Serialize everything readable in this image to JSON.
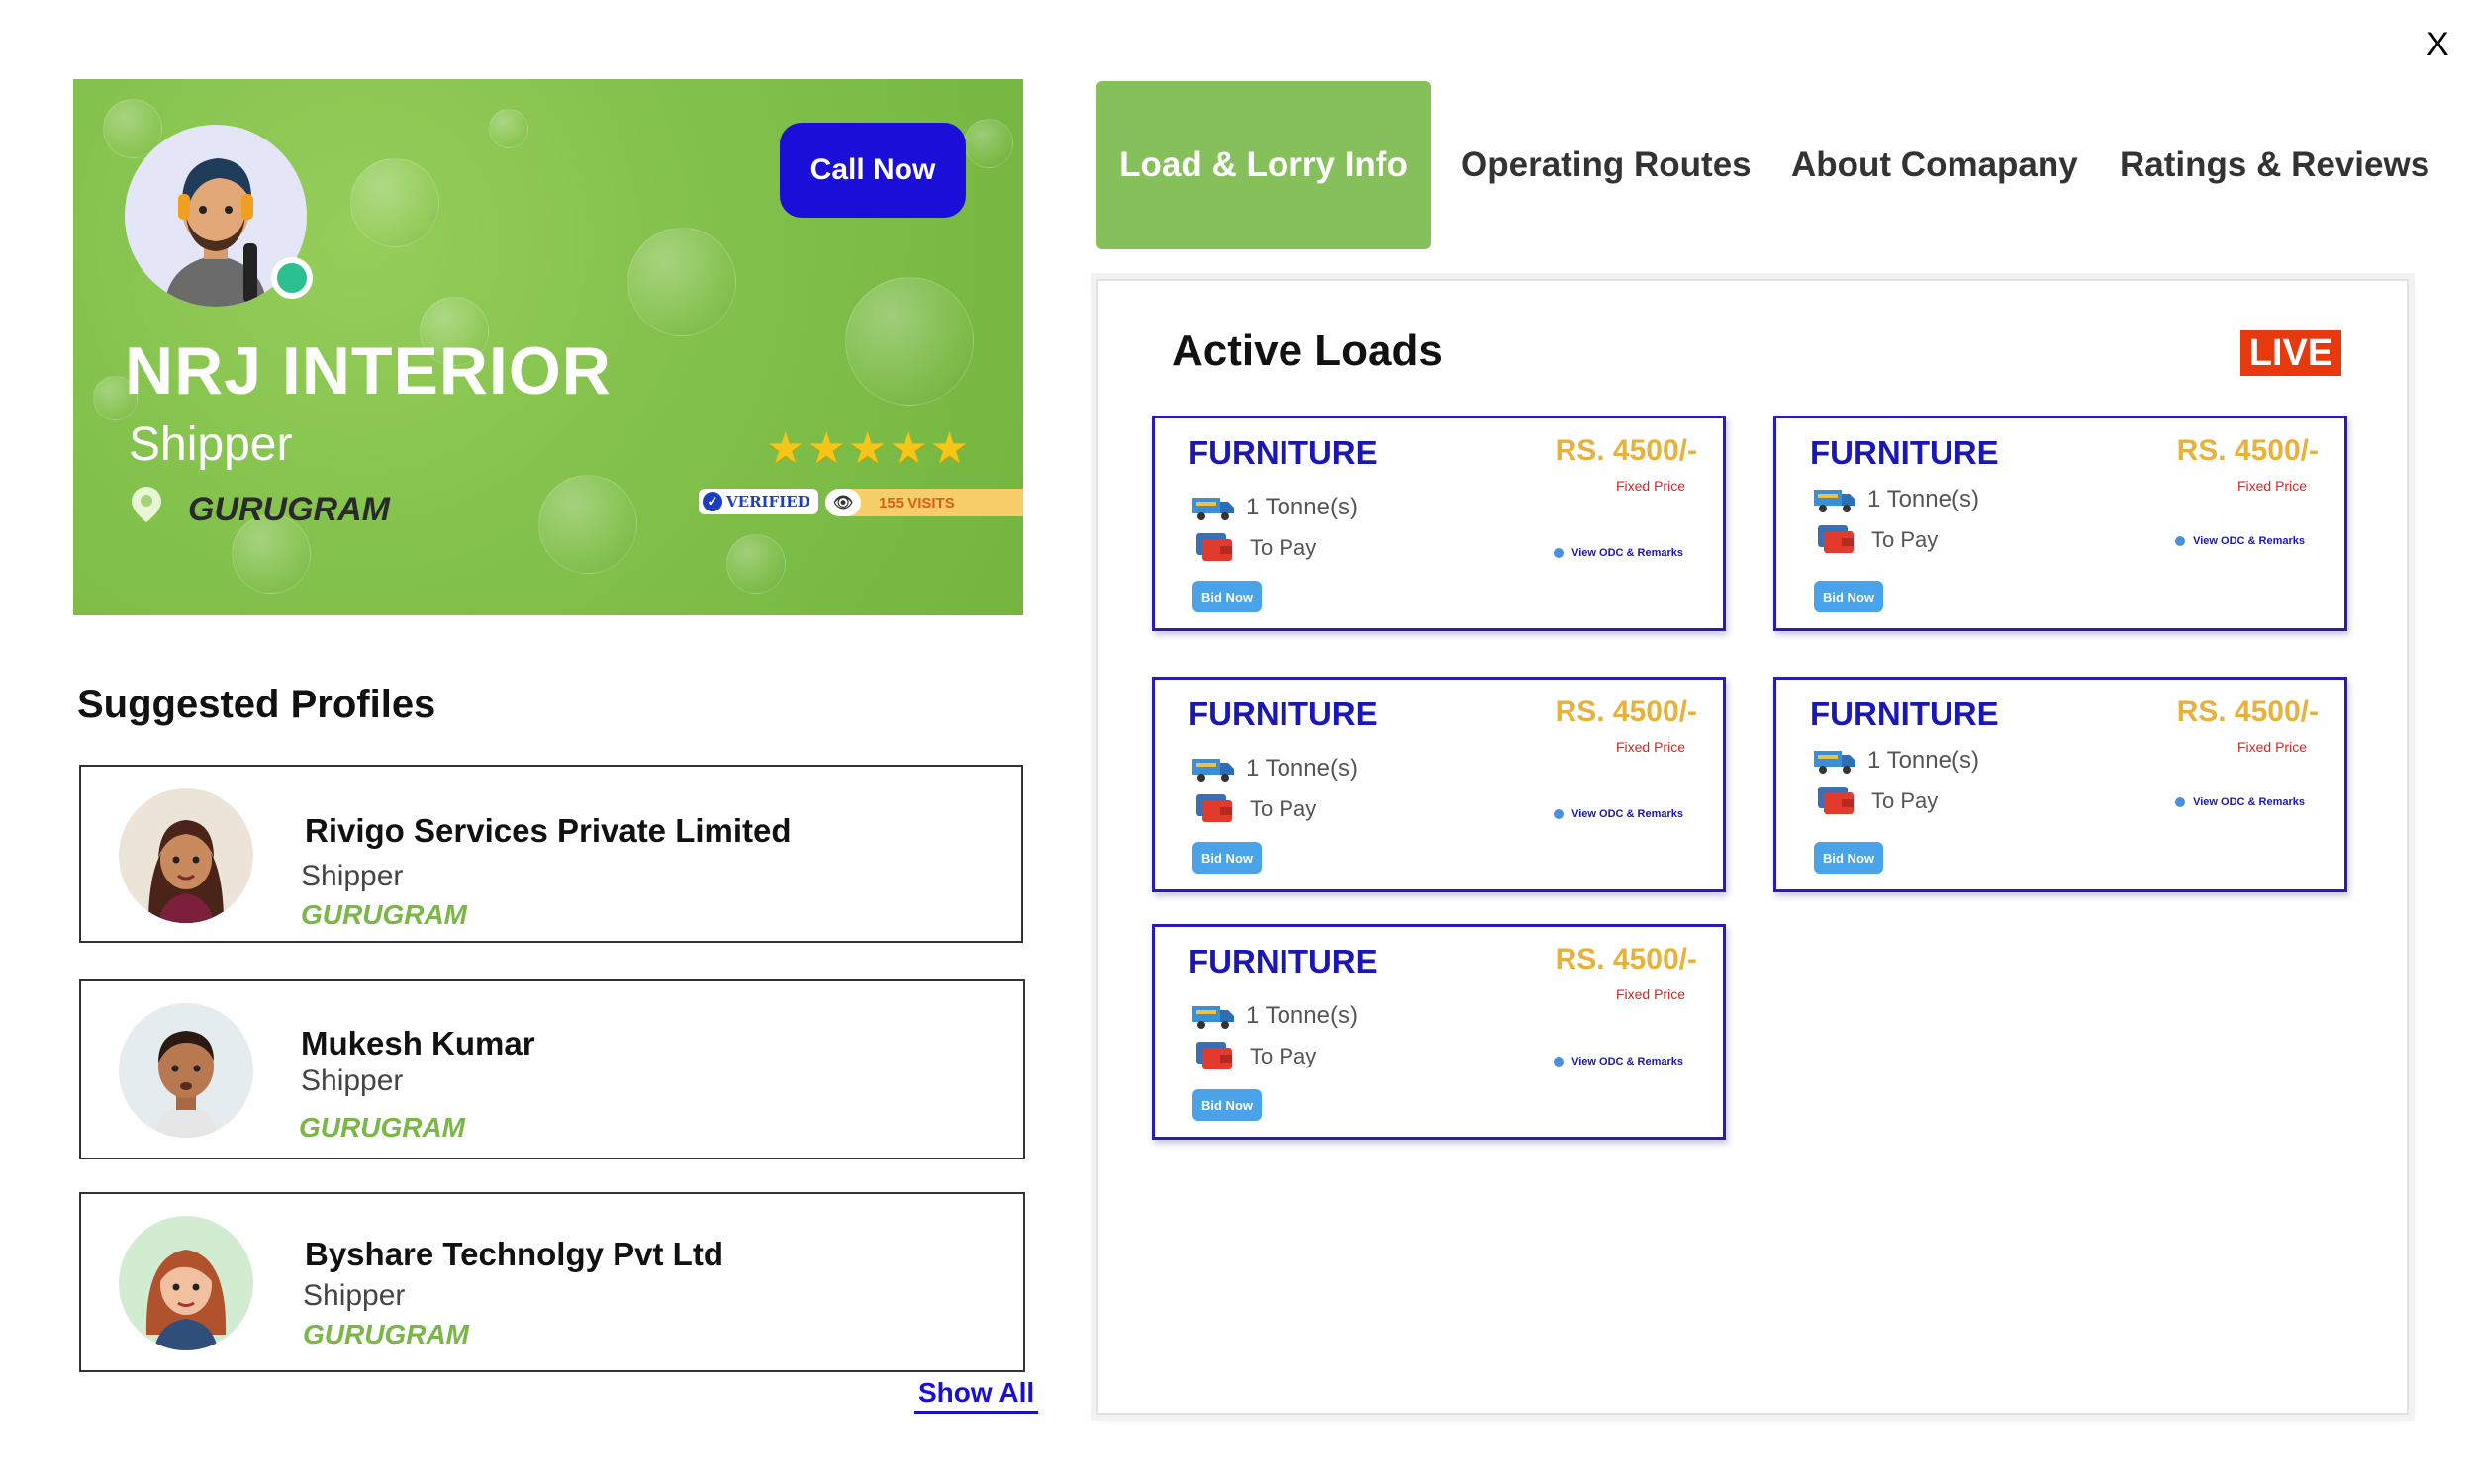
{
  "close_label": "X",
  "profile": {
    "call_label": "Call Now",
    "name": "NRJ INTERIOR",
    "role": "Shipper",
    "city": "GURUGRAM",
    "stars": "★★★★★",
    "rating_stars": 5,
    "verified_label": "VERIFIED",
    "visits_label": "155 VISITS",
    "background_color": "#82c14c",
    "online_color": "#2cbf8f"
  },
  "suggested": {
    "title": "Suggested Profiles",
    "items": [
      {
        "name": "Rivigo Services Private Limited",
        "role": "Shipper",
        "city": "GURUGRAM"
      },
      {
        "name": "Mukesh Kumar",
        "role": "Shipper",
        "city": "GURUGRAM"
      },
      {
        "name": "Byshare Technolgy Pvt Ltd",
        "role": "Shipper",
        "city": "GURUGRAM"
      }
    ],
    "show_all_label": "Show All"
  },
  "tabs": [
    {
      "label": "Load & Lorry Info",
      "active": true
    },
    {
      "label": "Operating Routes",
      "active": false
    },
    {
      "label": "About Comapany",
      "active": false
    },
    {
      "label": "Ratings & Reviews",
      "active": false
    }
  ],
  "active_loads": {
    "title": "Active Loads",
    "live_label": "LIVE",
    "cards": [
      {
        "title": "FURNITURE",
        "price": "RS. 4500/-",
        "price_type": "Fixed Price",
        "weight": "1 Tonne(s)",
        "payment": "To Pay",
        "odc_link": "View ODC & Remarks",
        "bid_label": "Bid Now"
      },
      {
        "title": "FURNITURE",
        "price": "RS. 4500/-",
        "price_type": "Fixed Price",
        "weight": "1 Tonne(s)",
        "payment": "To Pay",
        "odc_link": "View ODC & Remarks",
        "bid_label": "Bid Now"
      },
      {
        "title": "FURNITURE",
        "price": "RS. 4500/-",
        "price_type": "Fixed Price",
        "weight": "1 Tonne(s)",
        "payment": "To Pay",
        "odc_link": "View ODC & Remarks",
        "bid_label": "Bid Now"
      },
      {
        "title": "FURNITURE",
        "price": "RS. 4500/-",
        "price_type": "Fixed Price",
        "weight": "1 Tonne(s)",
        "payment": "To Pay",
        "odc_link": "View ODC & Remarks",
        "bid_label": "Bid Now"
      },
      {
        "title": "FURNITURE",
        "price": "RS. 4500/-",
        "price_type": "Fixed Price",
        "weight": "1 Tonne(s)",
        "payment": "To Pay",
        "odc_link": "View ODC & Remarks",
        "bid_label": "Bid Now"
      }
    ]
  },
  "colors": {
    "accent_green": "#86c05b",
    "call_button": "#1a0fd8",
    "card_title": "#1a17b4",
    "price": "#e6b23c",
    "live": "#e63a0e"
  }
}
